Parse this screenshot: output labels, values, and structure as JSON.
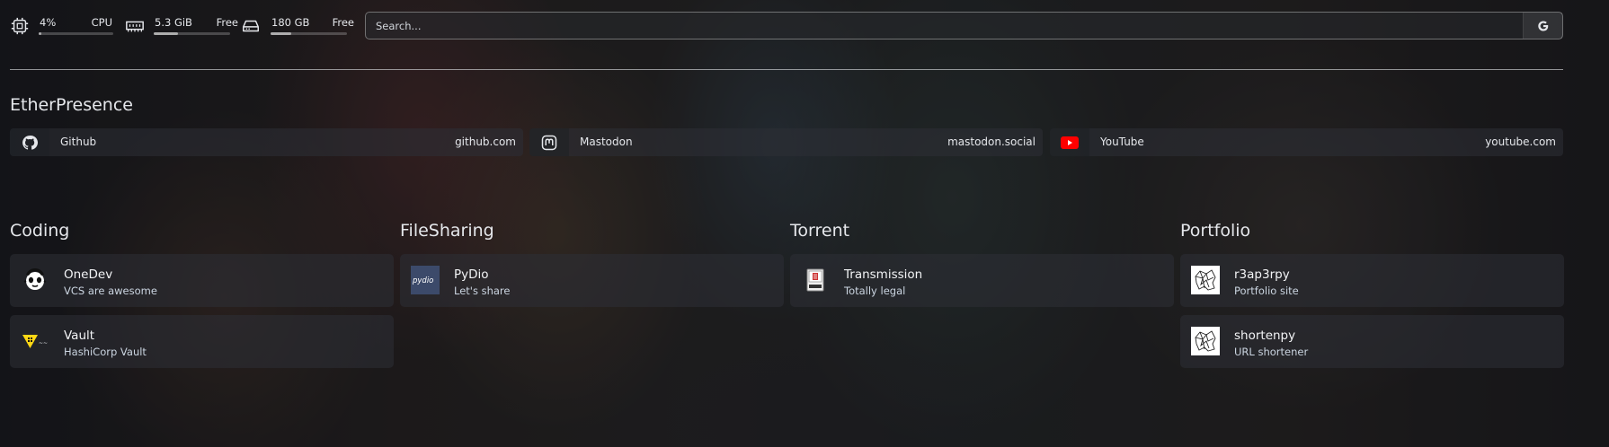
{
  "resources": {
    "cpu": {
      "value": "4%",
      "label": "CPU",
      "usage": 0.04,
      "icon": "cpu-icon"
    },
    "memory": {
      "value": "5.3 GiB",
      "label": "Free",
      "usage": 0.32,
      "icon": "memory-icon"
    },
    "disk": {
      "value": "180 GB",
      "label": "Free",
      "usage": 0.27,
      "icon": "disk-icon"
    }
  },
  "search": {
    "placeholder": "Search...",
    "provider_label": "G"
  },
  "bookmark_group": {
    "title": "EtherPresence",
    "items": [
      {
        "name": "Github",
        "url": "github.com",
        "icon": "github-icon"
      },
      {
        "name": "Mastodon",
        "url": "mastodon.social",
        "icon": "mastodon-icon"
      },
      {
        "name": "YouTube",
        "url": "youtube.com",
        "icon": "youtube-icon"
      }
    ]
  },
  "service_groups": [
    {
      "title": "Coding",
      "items": [
        {
          "name": "OneDev",
          "description": "VCS are awesome",
          "icon": "onedev-icon"
        },
        {
          "name": "Vault",
          "description": "HashiCorp Vault",
          "icon": "vault-icon"
        }
      ]
    },
    {
      "title": "FileSharing",
      "items": [
        {
          "name": "PyDio",
          "description": "Let's share",
          "icon": "pydio-icon",
          "icon_text": "pydio"
        }
      ]
    },
    {
      "title": "Torrent",
      "items": [
        {
          "name": "Transmission",
          "description": "Totally legal",
          "icon": "transmission-icon"
        }
      ]
    },
    {
      "title": "Portfolio",
      "items": [
        {
          "name": "r3ap3rpy",
          "description": "Portfolio site",
          "icon": "r3ap3rpy-icon"
        },
        {
          "name": "shortenpy",
          "description": "URL shortener",
          "icon": "shortenpy-icon"
        }
      ]
    }
  ],
  "colors": {
    "youtube": "#ff0000",
    "vault": "#ffd814",
    "pydio": "#3c4a6a"
  }
}
